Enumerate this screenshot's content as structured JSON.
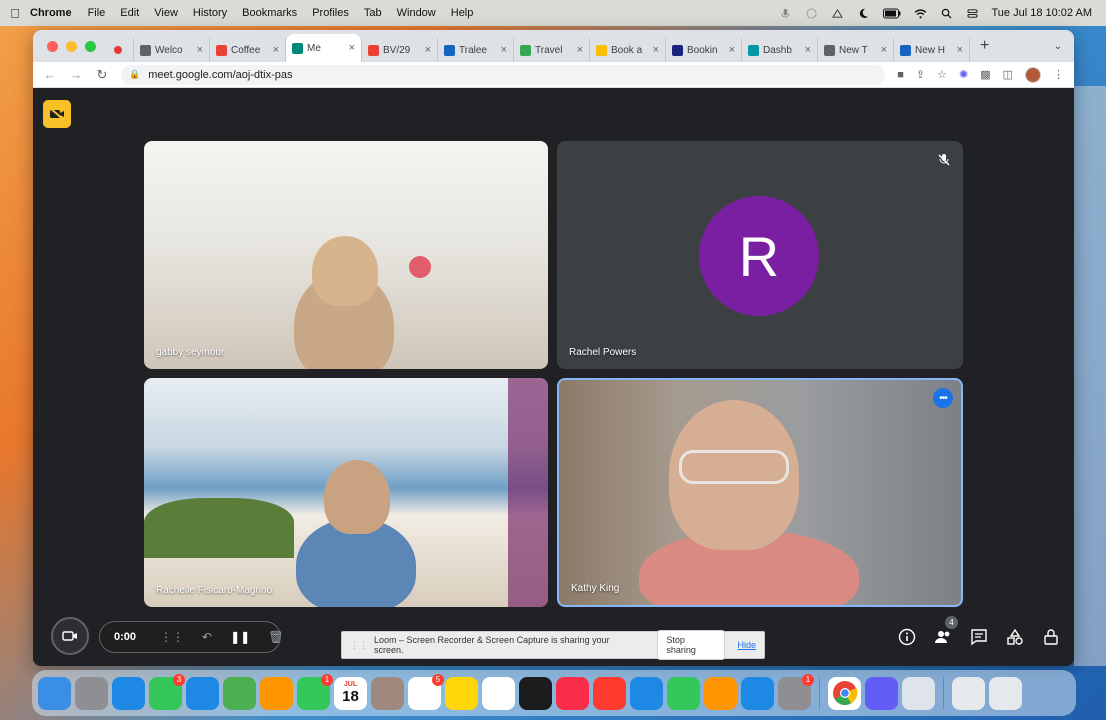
{
  "menubar": {
    "app": "Chrome",
    "items": [
      "File",
      "Edit",
      "View",
      "History",
      "Bookmarks",
      "Profiles",
      "Tab",
      "Window",
      "Help"
    ],
    "datetime": "Tue Jul 18  10:02 AM"
  },
  "browser": {
    "tabs": [
      {
        "title": "",
        "favicon_color": "#e53935",
        "recording": true
      },
      {
        "title": "Welco",
        "favicon_color": "#5f6368"
      },
      {
        "title": "Coffee",
        "favicon_color": "#ea4335"
      },
      {
        "title": "Me",
        "favicon_color": "#00897b",
        "active": true
      },
      {
        "title": "BV/29",
        "favicon_color": "#ea4335"
      },
      {
        "title": "Tralee",
        "favicon_color": "#1565c0"
      },
      {
        "title": "Travel",
        "favicon_color": "#34a853"
      },
      {
        "title": "Book a",
        "favicon_color": "#fbbc04"
      },
      {
        "title": "Bookin",
        "favicon_color": "#1a237e"
      },
      {
        "title": "Dashb",
        "favicon_color": "#0097a7"
      },
      {
        "title": "New T",
        "favicon_color": "#5f6368"
      },
      {
        "title": "New H",
        "favicon_color": "#1565c0"
      }
    ],
    "url": "meet.google.com/aoj-dtix-pas"
  },
  "meet": {
    "participants": [
      {
        "name": "gabby seymour"
      },
      {
        "name": "Rachel Powers",
        "initial": "R"
      },
      {
        "name": "Rachelle Fisicaro-Magrino"
      },
      {
        "name": "Kathy King"
      }
    ],
    "people_count": "4"
  },
  "loom": {
    "timer": "0:00"
  },
  "share_bar": {
    "message": "Loom – Screen Recorder & Screen Capture is sharing your screen.",
    "stop_label": "Stop sharing",
    "hide_label": "Hide"
  },
  "dock": {
    "calendar_day": "18",
    "calendar_month": "JUL",
    "apps": [
      {
        "name": "Finder",
        "color": "#3a8ee6"
      },
      {
        "name": "Launchpad",
        "color": "#8e8e93"
      },
      {
        "name": "Safari",
        "color": "#1e88e5"
      },
      {
        "name": "Messages",
        "color": "#34c759",
        "badge": "3"
      },
      {
        "name": "Mail",
        "color": "#1e88e5"
      },
      {
        "name": "Maps",
        "color": "#4caf50"
      },
      {
        "name": "Photos",
        "color": "#ff9500"
      },
      {
        "name": "FaceTime",
        "color": "#34c759",
        "badge": "1"
      },
      {
        "name": "Calendar",
        "color": "#ffffff"
      },
      {
        "name": "Contacts",
        "color": "#a1887f"
      },
      {
        "name": "Reminders",
        "color": "#ffffff",
        "badge": "5"
      },
      {
        "name": "Notes",
        "color": "#ffd60a"
      },
      {
        "name": "Freeform",
        "color": "#ffffff"
      },
      {
        "name": "TV",
        "color": "#1c1c1e"
      },
      {
        "name": "Music",
        "color": "#fa2d48"
      },
      {
        "name": "News",
        "color": "#ff3b30"
      },
      {
        "name": "Keynote",
        "color": "#1e88e5"
      },
      {
        "name": "Numbers",
        "color": "#34c759"
      },
      {
        "name": "Pages",
        "color": "#ff9500"
      },
      {
        "name": "App Store",
        "color": "#1e88e5"
      },
      {
        "name": "System Settings",
        "color": "#8e8e93",
        "badge": "1"
      },
      {
        "name": "Chrome",
        "color": "#ffffff"
      },
      {
        "name": "Loom",
        "color": "#625df5"
      },
      {
        "name": "Preview",
        "color": "#dfe4ea"
      },
      {
        "name": "Downloads",
        "color": "#e6e9ec"
      },
      {
        "name": "Trash",
        "color": "#e6e9ec"
      }
    ]
  }
}
